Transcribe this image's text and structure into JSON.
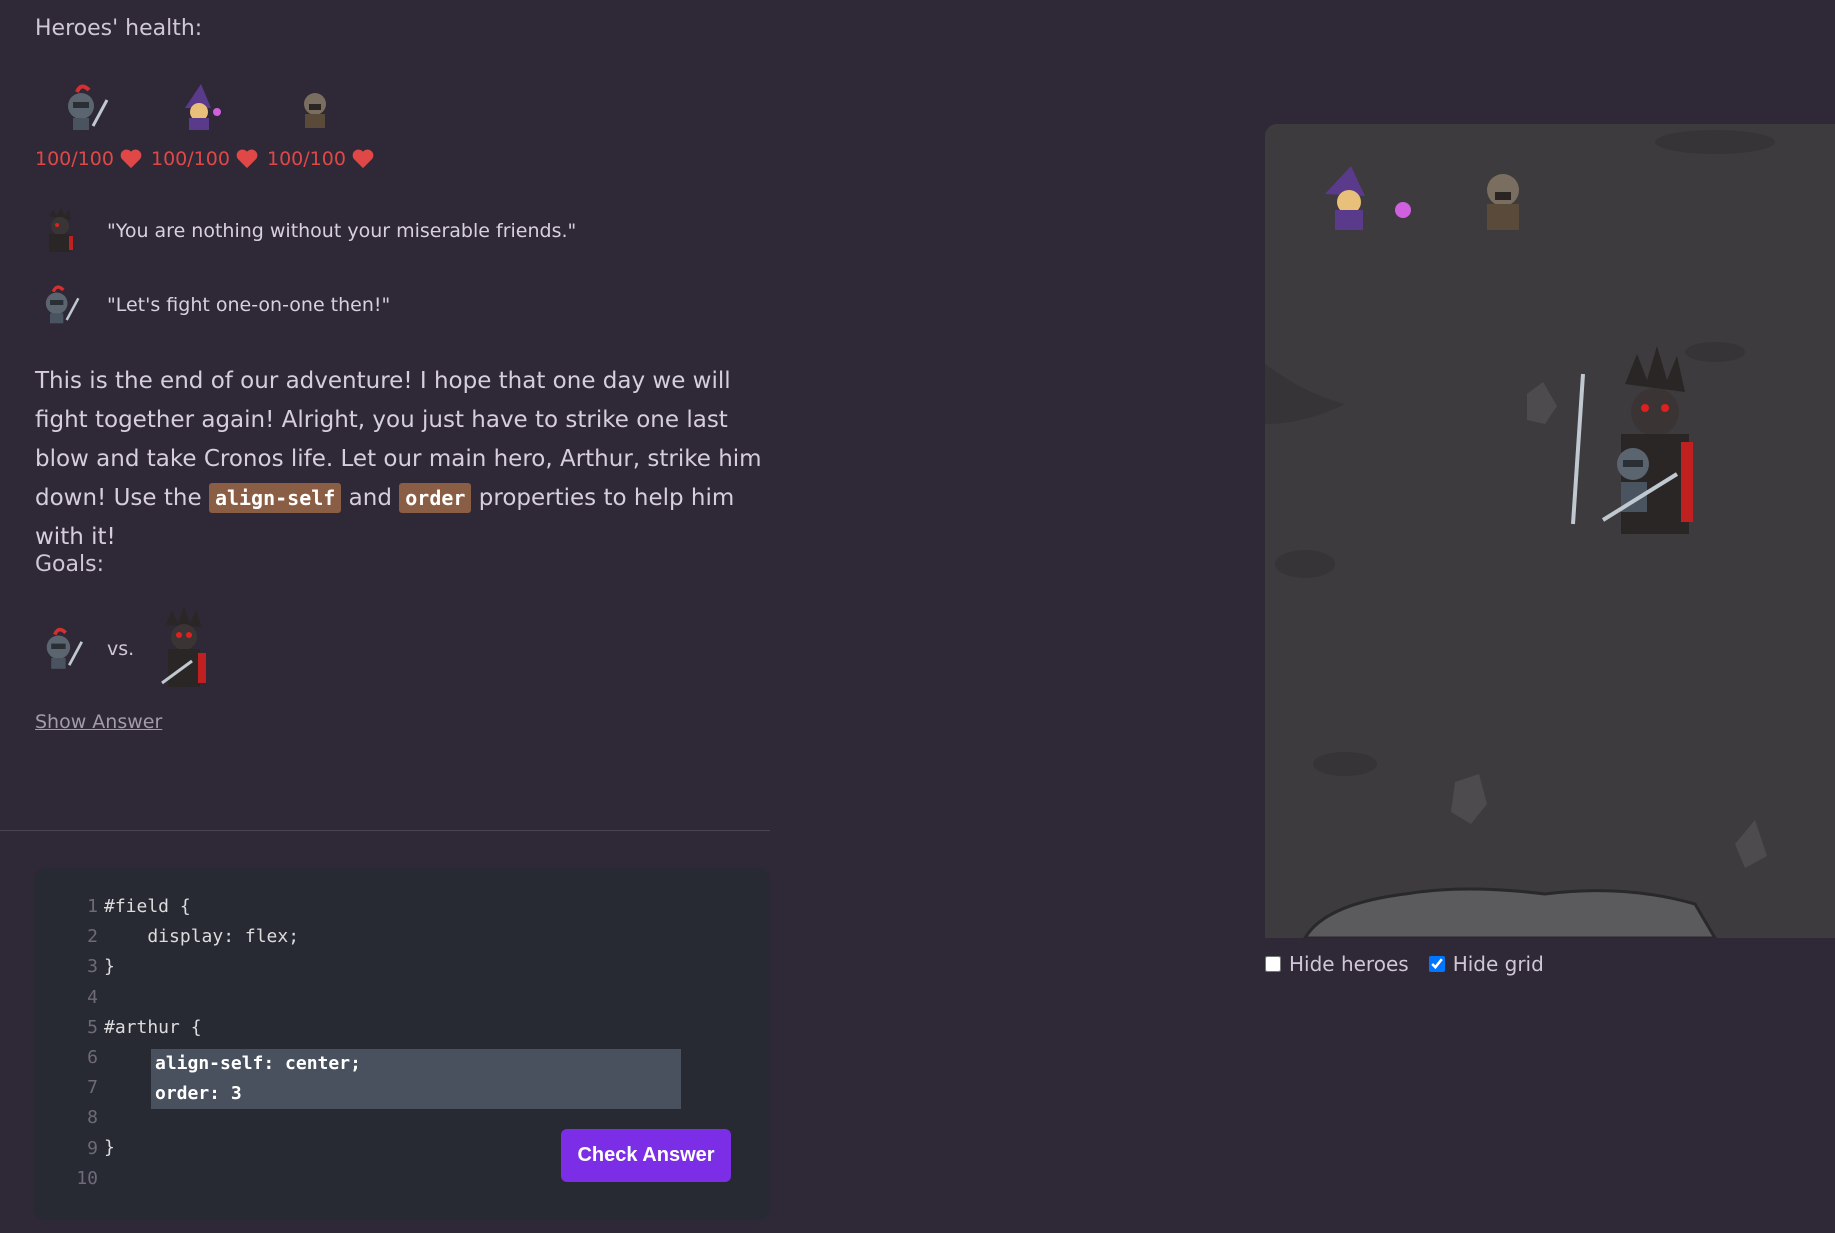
{
  "health": {
    "title": "Heroes' health:",
    "heroes": [
      {
        "name": "knight-icon",
        "hp": "100/100"
      },
      {
        "name": "wizard-icon",
        "hp": "100/100"
      },
      {
        "name": "rogue-icon",
        "hp": "100/100"
      }
    ]
  },
  "dialogue": [
    {
      "speaker": "cronos-icon",
      "text": "\"You are nothing without your miserable friends.\""
    },
    {
      "speaker": "knight-icon",
      "text": "\"Let's fight one-on-one then!\""
    }
  ],
  "instructions": {
    "part1": "This is the end of our adventure! I hope that one day we will fight together again! Alright, you just have to strike one last blow and take Cronos life. Let our main hero, Arthur, strike him down! Use the ",
    "code1": "align-self",
    "part2": " and ",
    "code2": "order",
    "part3": " properties to help him with it!"
  },
  "goals": {
    "title": "Goals:",
    "vs": "vs."
  },
  "show_answer": "Show Answer",
  "editor": {
    "line_numbers": "1\n2\n3\n4\n5\n6\n7\n8\n9\n10",
    "code_before": "#field {\n    display: flex;\n}\n\n#arthur {",
    "input_value": "align-self: center;\norder: 3",
    "code_after": "}",
    "check_label": "Check Answer"
  },
  "options": {
    "hide_heroes": "Hide heroes",
    "hide_heroes_checked": false,
    "hide_grid": "Hide grid",
    "hide_grid_checked": true
  },
  "colors": {
    "accent": "#7b2ee6",
    "heart": "#e04848",
    "code_tag": "#8a5e44",
    "background": "#2f2836"
  }
}
